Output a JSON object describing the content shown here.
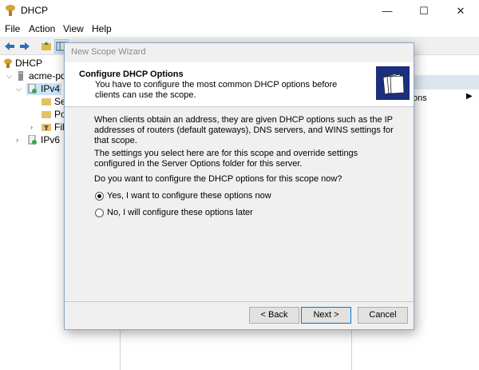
{
  "window": {
    "title": "DHCP",
    "controls": {
      "minimize": "—",
      "maximize": "☐",
      "close": "✕"
    }
  },
  "menu": [
    "File",
    "Action",
    "View",
    "Help"
  ],
  "toolbar": {
    "icons": [
      "back-arrow-icon",
      "forward-arrow-icon",
      "up-folder-icon",
      "show-tree-icon",
      "properties-icon",
      "export-icon",
      "help-icon",
      "view-icon",
      "refresh-icon"
    ]
  },
  "tree": {
    "root": "DHCP",
    "server": "acme-pdc",
    "ipv4": "IPv4",
    "ipv4_children": [
      "Se",
      "Po",
      "Fil"
    ],
    "ipv6": "IPv6"
  },
  "right_pane": {
    "more_actions": "ons"
  },
  "dialog": {
    "title": "New Scope Wizard",
    "header_title": "Configure DHCP Options",
    "header_desc": "You have to configure the most common DHCP options before clients can use the scope.",
    "para1": "When clients obtain an address, they are given DHCP options such as the IP addresses of routers (default gateways), DNS servers, and WINS settings for that scope.",
    "para2": "The settings you select here are for this scope and override settings configured in the Server Options folder for this server.",
    "question": "Do you want to configure the DHCP options for this scope now?",
    "option_yes": "Yes, I want to configure these options now",
    "option_no": "No, I will configure these options later",
    "selected_option": "yes",
    "back_label": "< Back",
    "next_label": "Next >",
    "cancel_label": "Cancel"
  }
}
